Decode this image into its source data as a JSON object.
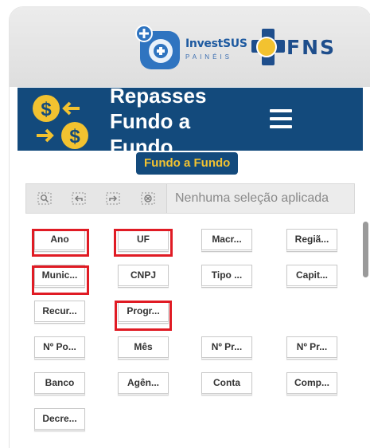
{
  "header": {
    "investsus_name": "InvestSUS",
    "investsus_sub": "PAINÉIS",
    "fns_name": "FNS"
  },
  "banner": {
    "title": "Repasses Fundo a Fundo"
  },
  "badge": {
    "label": "Fundo a Fundo"
  },
  "selection": {
    "status": "Nenhuma seleção aplicada"
  },
  "filters": [
    {
      "label": "Ano",
      "highlighted": true
    },
    {
      "label": "UF",
      "highlighted": true
    },
    {
      "label": "Macr...",
      "highlighted": false
    },
    {
      "label": "Regiã...",
      "highlighted": false
    },
    {
      "label": "Munic...",
      "highlighted": true
    },
    {
      "label": "CNPJ",
      "highlighted": false
    },
    {
      "label": "Tipo ...",
      "highlighted": false
    },
    {
      "label": "Capit...",
      "highlighted": false
    },
    {
      "label": "Recur...",
      "highlighted": false
    },
    {
      "label": "Progr...",
      "highlighted": true
    },
    {
      "label": "Nº Po...",
      "highlighted": false
    },
    {
      "label": "Mês",
      "highlighted": false
    },
    {
      "label": "Nº Pr...",
      "highlighted": false
    },
    {
      "label": "Nº Pr...",
      "highlighted": false
    },
    {
      "label": "Banco",
      "highlighted": false
    },
    {
      "label": "Agên...",
      "highlighted": false
    },
    {
      "label": "Conta",
      "highlighted": false
    },
    {
      "label": "Comp...",
      "highlighted": false
    },
    {
      "label": "Decre...",
      "highlighted": false
    }
  ],
  "colors": {
    "brand_blue": "#134a7c",
    "accent_gold": "#f2c230",
    "highlight_red": "#e01b24"
  }
}
